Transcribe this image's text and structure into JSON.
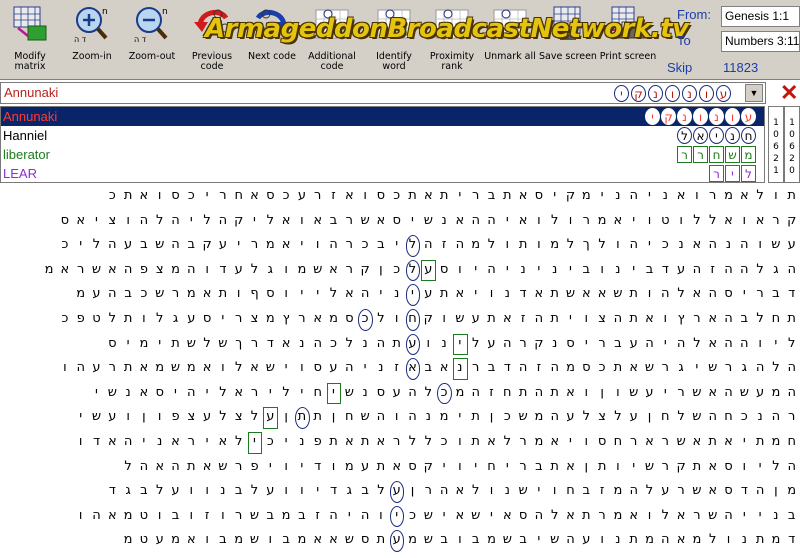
{
  "toolbar": {
    "buttons": [
      {
        "id": "modify-matrix",
        "label": "Modify matrix",
        "icon": "grid-arrow-icon"
      },
      {
        "id": "zoom-in",
        "label": "Zoom-in",
        "icon": "magnifier-plus-icon"
      },
      {
        "id": "zoom-out",
        "label": "Zoom-out",
        "icon": "magnifier-minus-icon"
      },
      {
        "id": "previous-code",
        "label": "Previous code",
        "icon": "prev-arrow-icon"
      },
      {
        "id": "next-code",
        "label": "Next code",
        "icon": "next-arrow-icon"
      },
      {
        "id": "additional-code",
        "label": "Additional code",
        "icon": "letter-grid-icon"
      },
      {
        "id": "identify-word",
        "label": "Identify word",
        "icon": "letter-grid-icon"
      },
      {
        "id": "proximity-rank",
        "label": "Proximity rank",
        "icon": "letter-grid-icon"
      },
      {
        "id": "unmark-all",
        "label": "Unmark all",
        "icon": "letter-grid-icon"
      },
      {
        "id": "save-screen",
        "label": "Save screen",
        "icon": "save-grid-icon"
      },
      {
        "id": "print-screen",
        "label": "Print screen",
        "icon": "printer-icon"
      }
    ],
    "watermark": "ArmageddonBroadcastNetwork.tv",
    "from_label": "From:",
    "from_value": "Genesis 1:1",
    "to_label": "To",
    "to_value": "Numbers 3:11",
    "skip_label": "Skip",
    "skip_value": "11823"
  },
  "search": {
    "value": "Annunaki",
    "letters": [
      "י",
      "ק",
      "נ",
      "ו",
      "נ",
      "ו",
      "ע"
    ],
    "dropdown_icon": "chevron-down-icon",
    "close_icon": "close-x-icon"
  },
  "terms": [
    {
      "label": "Annunaki",
      "color": "#ff3b30",
      "selected": true,
      "letters": [
        "י",
        "ק",
        "נ",
        "ו",
        "נ",
        "ו",
        "ע"
      ],
      "mark": "oval"
    },
    {
      "label": "Hanniel",
      "color": "#000000",
      "selected": false,
      "letters": [
        "ל",
        "א",
        "י",
        "נ",
        "ח"
      ],
      "mark": "oval"
    },
    {
      "label": "liberator",
      "color": "#1e7a1e",
      "selected": false,
      "letters": [
        "ר",
        "ר",
        "ח",
        "ש",
        "מ"
      ],
      "mark": "box"
    },
    {
      "label": "LEAR",
      "color": "#8e2bd6",
      "selected": false,
      "letters": [
        "ר",
        "י",
        "ל"
      ],
      "mark": "box"
    }
  ],
  "side_panels": [
    {
      "digits": [
        "1",
        "0",
        "6",
        "2",
        "1"
      ]
    },
    {
      "digits": [
        "1",
        "0",
        "6",
        "2",
        "0"
      ]
    }
  ],
  "colors": {
    "toolbar_bg": "#d4d0c8",
    "selected_row_bg": "#0a246a",
    "oval_marker": "#1b2a80",
    "box_marker": "#1e7a1e"
  },
  "matrix": {
    "rows": [
      "תולאמרואניהנימקיסאתברית אתכסואזרעכסאחריכסו אתכ",
      "קראואללוטויאמרולואיההאנשיסאשרבאואליקהליהלהוציאס",
      "עשוהנהאנכיהולךלמותולמהזהליבכרהויאמריעקבהשבעהליכ",
      "הגלההזהעדבינוביניניהיוסעלכןקראשמוגלעדוהמצפהאשראמ",
      "דבריסהאלהותשאאשתאדנויאתעיניהאלייוסףותאמרשכבהעמ",
      "תחלבהארץואתהצויתהזאתעשוקחולכסמארץמצריסעגלותלטפכ",
      "ליוההאלהיהעבריסנקרהעלינועתהנלכהנאדרךשלשתימיס",
      "הלהגרשיגרשאתכסמהזהדברנאבאזניהעסוישאלוא משמאתרעהו",
      "המעשהאשריעשוןואתהתחזהמכלהעסנשיחילירא ליהיסאנשי",
      "רהנכחהשלחןעלצלעהמשכןתימנהוהשחןתתןעלצלעצפוןועשי",
      "חמתיאתאשרארחסויאמרלאתוכללראתאתפניכילאיראניהאדו",
      "הליוסאתקרשיותןאתבריחיויקסאתעמודיויפרשאתהאהל",
      "מןהדסאשרעלהמזבחוישנולאהרןעלבגדיוועלבנוועלבגד",
      "בנייהשראלואמרתאלהסאישאישכיוהיהזבמבשרוזובוטמאהו",
      "דמתנולמאהמתנועהשיבשמבובשמעתסשאאמבושמבואמעטמ"
    ],
    "markers": [
      {
        "row": 2,
        "col": 24,
        "type": "oval"
      },
      {
        "row": 3,
        "col": 24,
        "type": "oval"
      },
      {
        "row": 4,
        "col": 24,
        "type": "oval"
      },
      {
        "row": 5,
        "col": 24,
        "type": "oval"
      },
      {
        "row": 6,
        "col": 24,
        "type": "oval"
      },
      {
        "row": 7,
        "col": 24,
        "type": "oval"
      },
      {
        "row": 3,
        "col": 23,
        "type": "box"
      },
      {
        "row": 5,
        "col": 27,
        "type": "oval"
      },
      {
        "row": 6,
        "col": 21,
        "type": "box"
      },
      {
        "row": 7,
        "col": 21,
        "type": "box"
      },
      {
        "row": 8,
        "col": 22,
        "type": "oval"
      },
      {
        "row": 8,
        "col": 29,
        "type": "box"
      },
      {
        "row": 9,
        "col": 33,
        "type": "box"
      },
      {
        "row": 9,
        "col": 31,
        "type": "oval"
      },
      {
        "row": 10,
        "col": 34,
        "type": "box"
      },
      {
        "row": 12,
        "col": 25,
        "type": "oval"
      },
      {
        "row": 13,
        "col": 25,
        "type": "oval"
      },
      {
        "row": 14,
        "col": 25,
        "type": "oval"
      }
    ]
  }
}
